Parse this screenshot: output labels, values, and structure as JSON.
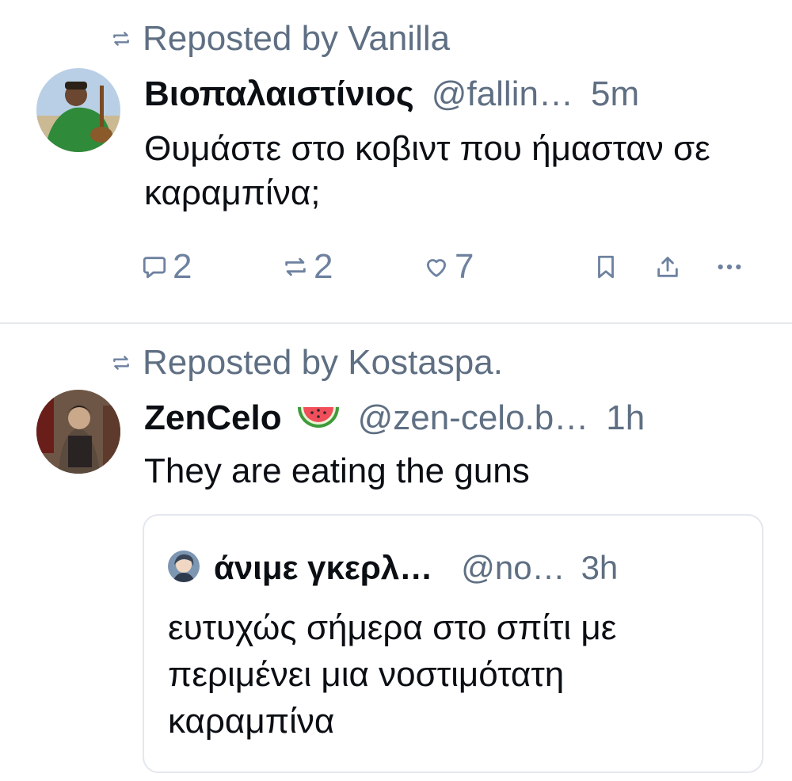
{
  "posts": [
    {
      "repost_label": "Reposted by Vanilla",
      "display_name": "Βιοπαλαιστίνιος",
      "handle": "@fallin…",
      "time": "5m",
      "text": "Θυμάστε στο κοβιντ που ήμασταν σε καραμπίνα;",
      "counts": {
        "replies": "2",
        "reposts": "2",
        "likes": "7"
      },
      "icons": [
        "repost-icon",
        "reply-icon",
        "like-icon",
        "bookmark-icon",
        "share-icon",
        "more-icon"
      ]
    },
    {
      "repost_label": "Reposted by Kostaspa.",
      "display_name": "ZenCelo",
      "name_emoji": "watermelon-icon",
      "handle": "@zen-celo.b…",
      "time": "1h",
      "text": "They are eating the guns",
      "quote": {
        "display_name": "άνιμε γκερλ…",
        "handle": "@no…",
        "time": "3h",
        "text": "ευτυχώς σήμερα στο σπίτι με περιμένει μια νοστιμότατη καραμπίνα"
      }
    }
  ],
  "colors": {
    "muted_text": "#5f6f83",
    "action_icons": "#6e82a0",
    "divider": "#e6eaef",
    "text": "#0b0f14"
  }
}
